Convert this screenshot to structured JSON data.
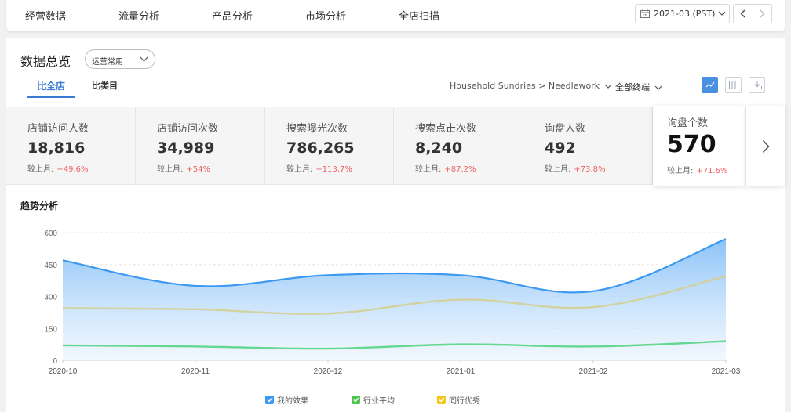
{
  "topnav": {
    "items": [
      "经营数据",
      "流量分析",
      "产品分析",
      "市场分析",
      "全店扫描"
    ],
    "date": "2021-03 (PST)"
  },
  "header": {
    "title": "数据总览",
    "preset": "运营常用",
    "tabs": [
      "比全店",
      "比类目"
    ],
    "category": "Household Sundries > Needlework",
    "terminal": "全部终端"
  },
  "metrics": [
    {
      "label": "店铺访问人数",
      "value": "18,816",
      "cmp_label": "较上月:",
      "change": "+49.6%"
    },
    {
      "label": "店铺访问次数",
      "value": "34,989",
      "cmp_label": "较上月:",
      "change": "+54%"
    },
    {
      "label": "搜索曝光次数",
      "value": "786,265",
      "cmp_label": "较上月:",
      "change": "+113.7%"
    },
    {
      "label": "搜索点击次数",
      "value": "8,240",
      "cmp_label": "较上月:",
      "change": "+87.2%"
    },
    {
      "label": "询盘人数",
      "value": "492",
      "cmp_label": "较上月:",
      "change": "+73.8%"
    },
    {
      "label": "询盘个数",
      "value": "570",
      "cmp_label": "较上月:",
      "change": "+71.6%"
    }
  ],
  "trend": {
    "title": "趋势分析"
  },
  "colors": {
    "accent": "#3a7bd5",
    "up": "#ef5f5f",
    "mine": "#3d98f0",
    "industry": "#4cd17e",
    "peers": "#f5c518"
  },
  "chart_data": {
    "type": "area",
    "x": [
      "2020-10",
      "2020-11",
      "2020-12",
      "2021-01",
      "2021-02",
      "2021-03"
    ],
    "yticks": [
      0,
      150,
      300,
      450,
      600
    ],
    "ylim": [
      0,
      600
    ],
    "grid": true,
    "legend_position": "bottom",
    "series": [
      {
        "name": "我的效果",
        "values": [
          470,
          350,
          400,
          400,
          325,
          570
        ],
        "color": "#3d98f0"
      },
      {
        "name": "行业平均",
        "values": [
          70,
          65,
          55,
          75,
          65,
          90
        ],
        "color": "#4cd17e"
      },
      {
        "name": "同行优秀",
        "values": [
          245,
          240,
          220,
          285,
          250,
          395
        ],
        "color": "#d4cf8e"
      }
    ]
  }
}
